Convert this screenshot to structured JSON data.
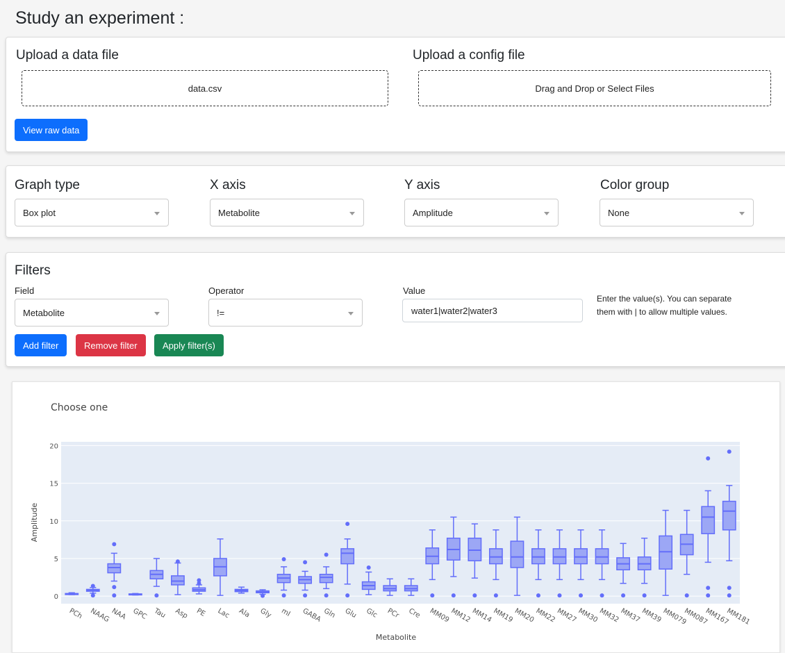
{
  "page": {
    "title": "Study an experiment :"
  },
  "upload": {
    "data_title": "Upload a data file",
    "data_filename": "data.csv",
    "config_title": "Upload a config file",
    "config_prompt": "Drag and Drop or Select Files",
    "view_raw_label": "View raw data"
  },
  "graph_settings": {
    "graph_type_label": "Graph type",
    "graph_type_value": "Box plot",
    "x_axis_label": "X axis",
    "x_axis_value": "Metabolite",
    "y_axis_label": "Y axis",
    "y_axis_value": "Amplitude",
    "color_group_label": "Color group",
    "color_group_value": "None"
  },
  "filters": {
    "title": "Filters",
    "field_label": "Field",
    "field_value": "Metabolite",
    "operator_label": "Operator",
    "operator_value": "!=",
    "value_label": "Value",
    "value_input": "water1|water2|water3",
    "help_line1": "Enter the value(s). You can separate",
    "help_line2": "them with | to allow multiple values.",
    "add_label": "Add filter",
    "remove_label": "Remove filter",
    "apply_label": "Apply filter(s)"
  },
  "colors": {
    "box_fill": "#9ca7f5",
    "box_line": "#636efa",
    "plot_bg": "#e5ecf6",
    "primary": "#0d6efd",
    "danger": "#dc3545",
    "success": "#198754"
  },
  "chart_data": {
    "type": "box",
    "title": "Choose one",
    "xlabel": "Metabolite",
    "ylabel": "Amplitude",
    "ylim": [
      -1,
      20.5
    ],
    "yticks": [
      0,
      5,
      10,
      15,
      20
    ],
    "grid": true,
    "categories": [
      "PCh",
      "NAAG",
      "NAA",
      "GPC",
      "Tau",
      "Asp",
      "PE",
      "Lac",
      "Ala",
      "Gly",
      "mI",
      "GABA",
      "Gln",
      "Glu",
      "Glc",
      "PCr",
      "Cre",
      "MM09",
      "MM12",
      "MM14",
      "MM19",
      "MM20",
      "MM22",
      "MM27",
      "MM30",
      "MM32",
      "MM37",
      "MM39",
      "MM079",
      "MM087",
      "MM167",
      "MM181"
    ],
    "boxes": [
      {
        "min": 0.2,
        "q1": 0.25,
        "median": 0.3,
        "q3": 0.35,
        "max": 0.45,
        "outliers": []
      },
      {
        "min": 0.4,
        "q1": 0.65,
        "median": 0.75,
        "q3": 0.9,
        "max": 1.15,
        "outliers": [
          1.35,
          0.1
        ]
      },
      {
        "min": 2.0,
        "q1": 3.1,
        "median": 3.8,
        "q3": 4.3,
        "max": 5.7,
        "outliers": [
          6.9,
          1.2,
          0.1
        ]
      },
      {
        "min": 0.15,
        "q1": 0.2,
        "median": 0.25,
        "q3": 0.3,
        "max": 0.35,
        "outliers": []
      },
      {
        "min": 1.3,
        "q1": 2.3,
        "median": 2.9,
        "q3": 3.4,
        "max": 5.0,
        "outliers": [
          0.1
        ]
      },
      {
        "min": 0.2,
        "q1": 1.5,
        "median": 2.0,
        "q3": 2.7,
        "max": 4.4,
        "outliers": [
          4.6
        ]
      },
      {
        "min": 0.3,
        "q1": 0.65,
        "median": 0.85,
        "q3": 1.1,
        "max": 1.5,
        "outliers": [
          1.7,
          2.1
        ]
      },
      {
        "min": 0.1,
        "q1": 2.7,
        "median": 3.9,
        "q3": 5.0,
        "max": 7.6,
        "outliers": []
      },
      {
        "min": 0.4,
        "q1": 0.6,
        "median": 0.75,
        "q3": 0.9,
        "max": 1.2,
        "outliers": []
      },
      {
        "min": 0.25,
        "q1": 0.45,
        "median": 0.55,
        "q3": 0.7,
        "max": 0.85,
        "outliers": [
          0.05
        ]
      },
      {
        "min": 0.8,
        "q1": 1.8,
        "median": 2.4,
        "q3": 2.9,
        "max": 3.9,
        "outliers": [
          4.9,
          0.1
        ]
      },
      {
        "min": 0.8,
        "q1": 1.7,
        "median": 2.2,
        "q3": 2.6,
        "max": 3.3,
        "outliers": [
          4.5,
          0.1
        ]
      },
      {
        "min": 1.0,
        "q1": 1.8,
        "median": 2.5,
        "q3": 2.9,
        "max": 3.9,
        "outliers": [
          5.5,
          0.1
        ]
      },
      {
        "min": 1.6,
        "q1": 4.3,
        "median": 5.7,
        "q3": 6.3,
        "max": 7.6,
        "outliers": [
          9.6,
          0.1
        ]
      },
      {
        "min": 0.2,
        "q1": 0.9,
        "median": 1.4,
        "q3": 1.9,
        "max": 3.2,
        "outliers": [
          3.8
        ]
      },
      {
        "min": 0.1,
        "q1": 0.7,
        "median": 1.0,
        "q3": 1.4,
        "max": 2.3,
        "outliers": []
      },
      {
        "min": 0.1,
        "q1": 0.7,
        "median": 1.0,
        "q3": 1.4,
        "max": 2.3,
        "outliers": []
      },
      {
        "min": 2.2,
        "q1": 4.3,
        "median": 5.3,
        "q3": 6.4,
        "max": 8.8,
        "outliers": [
          0.1
        ]
      },
      {
        "min": 2.6,
        "q1": 4.8,
        "median": 6.2,
        "q3": 7.7,
        "max": 10.5,
        "outliers": [
          0.1
        ]
      },
      {
        "min": 2.4,
        "q1": 4.7,
        "median": 6.1,
        "q3": 7.7,
        "max": 9.6,
        "outliers": [
          0.1
        ]
      },
      {
        "min": 2.2,
        "q1": 4.3,
        "median": 5.2,
        "q3": 6.3,
        "max": 8.8,
        "outliers": [
          0.1
        ]
      },
      {
        "min": 0.1,
        "q1": 3.8,
        "median": 5.2,
        "q3": 7.3,
        "max": 10.5,
        "outliers": []
      },
      {
        "min": 2.2,
        "q1": 4.3,
        "median": 5.2,
        "q3": 6.3,
        "max": 8.8,
        "outliers": [
          0.1
        ]
      },
      {
        "min": 2.2,
        "q1": 4.3,
        "median": 5.2,
        "q3": 6.3,
        "max": 8.8,
        "outliers": [
          0.1
        ]
      },
      {
        "min": 2.2,
        "q1": 4.3,
        "median": 5.2,
        "q3": 6.3,
        "max": 8.8,
        "outliers": [
          0.1
        ]
      },
      {
        "min": 2.2,
        "q1": 4.3,
        "median": 5.2,
        "q3": 6.3,
        "max": 8.8,
        "outliers": [
          0.1
        ]
      },
      {
        "min": 1.7,
        "q1": 3.5,
        "median": 4.3,
        "q3": 5.1,
        "max": 7.0,
        "outliers": [
          0.1
        ]
      },
      {
        "min": 1.7,
        "q1": 3.5,
        "median": 4.3,
        "q3": 5.2,
        "max": 7.7,
        "outliers": [
          0.1
        ]
      },
      {
        "min": 0.1,
        "q1": 3.6,
        "median": 5.9,
        "q3": 8.0,
        "max": 11.4,
        "outliers": []
      },
      {
        "min": 2.9,
        "q1": 5.5,
        "median": 6.9,
        "q3": 8.2,
        "max": 11.4,
        "outliers": [
          0.1
        ]
      },
      {
        "min": 4.5,
        "q1": 8.3,
        "median": 10.5,
        "q3": 11.9,
        "max": 14.0,
        "outliers": [
          18.3,
          1.1,
          0.1
        ]
      },
      {
        "min": 4.7,
        "q1": 8.8,
        "median": 11.3,
        "q3": 12.6,
        "max": 14.7,
        "outliers": [
          19.2,
          1.1,
          0.1
        ]
      }
    ]
  }
}
